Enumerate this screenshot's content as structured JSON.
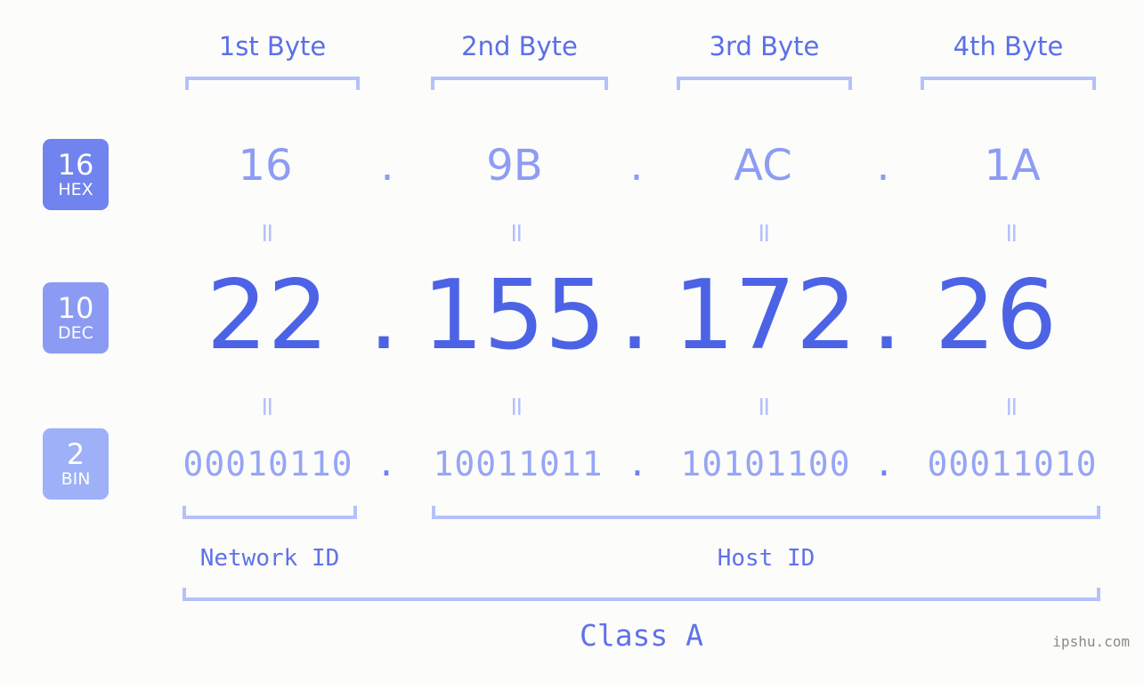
{
  "diagram": {
    "title_class": "Class A",
    "watermark": "ipshu.com",
    "colors": {
      "background": "#fcfdfa",
      "bracket": "#b6c0fa",
      "header_text": "#5b6fe8",
      "hex_text": "#8d9cf4",
      "dec_text": "#4d63e6",
      "bin_text": "#96a5f5",
      "label_text": "#6071e9",
      "badge_hex": "#7183ee",
      "badge_dec": "#8b9bf4",
      "badge_bin": "#9db0f8",
      "watermark_text": "#8a8a8a"
    }
  },
  "byte_headers": [
    {
      "label": "1st Byte"
    },
    {
      "label": "2nd Byte"
    },
    {
      "label": "3rd Byte"
    },
    {
      "label": "4th Byte"
    }
  ],
  "bases": [
    {
      "num": "16",
      "label": "HEX"
    },
    {
      "num": "10",
      "label": "DEC"
    },
    {
      "num": "2",
      "label": "BIN"
    }
  ],
  "rows": {
    "hex": {
      "values": [
        "16",
        "9B",
        "AC",
        "1A"
      ],
      "separator": "."
    },
    "dec": {
      "values": [
        "22",
        "155",
        "172",
        "26"
      ],
      "separator": "."
    },
    "bin": {
      "values": [
        "00010110",
        "10011011",
        "10101100",
        "00011010"
      ],
      "separator": "."
    }
  },
  "equals_marks": {
    "glyph": "=",
    "row1": [
      "=",
      "=",
      "=",
      "="
    ],
    "row2": [
      "=",
      "=",
      "=",
      "="
    ]
  },
  "id_sections": [
    {
      "label": "Network ID"
    },
    {
      "label": "Host ID"
    }
  ]
}
